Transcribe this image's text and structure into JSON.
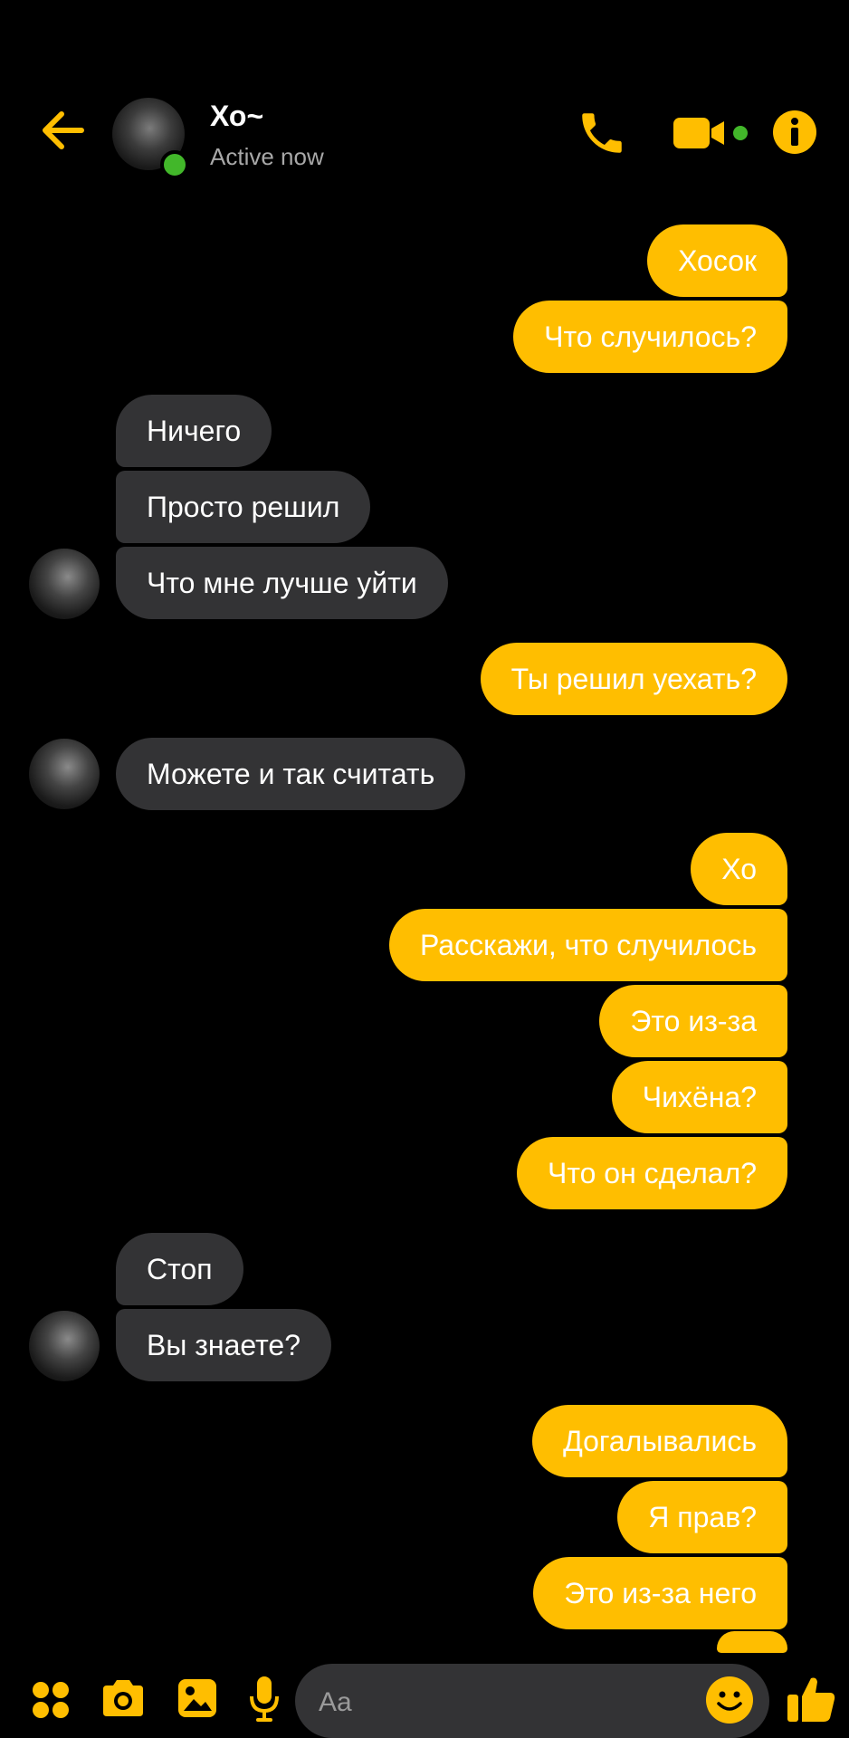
{
  "theme": {
    "accent": "#ffbe00",
    "background": "#000000",
    "incoming_bubble": "#333335",
    "online": "#42b72a"
  },
  "header": {
    "contact_name": "Хо~",
    "status": "Active now",
    "icons": [
      "back-arrow-icon",
      "phone-icon",
      "video-camera-icon",
      "info-icon"
    ]
  },
  "messages": [
    {
      "from": "me",
      "text": "Хосок"
    },
    {
      "from": "me",
      "text": "Что случилось?"
    },
    {
      "from": "contact",
      "text": "Ничего"
    },
    {
      "from": "contact",
      "text": "Просто решил"
    },
    {
      "from": "contact",
      "text": "Что мне лучше уйти"
    },
    {
      "from": "me",
      "text": "Ты решил уехать?"
    },
    {
      "from": "contact",
      "text": "Можете и так считать"
    },
    {
      "from": "me",
      "text": "Хо"
    },
    {
      "from": "me",
      "text": "Расскажи, что случилось"
    },
    {
      "from": "me",
      "text": "Это из-за"
    },
    {
      "from": "me",
      "text": "Чихёна?"
    },
    {
      "from": "me",
      "text": "Что он сделал?"
    },
    {
      "from": "contact",
      "text": "Стоп"
    },
    {
      "from": "contact",
      "text": "Вы знаете?"
    },
    {
      "from": "me",
      "text": "Догалывались"
    },
    {
      "from": "me",
      "text": "Я прав?"
    },
    {
      "from": "me",
      "text": "Это из-за него"
    }
  ],
  "composer": {
    "placeholder": "Aa",
    "icons": [
      "apps-icon",
      "camera-icon",
      "gallery-icon",
      "microphone-icon",
      "emoji-icon",
      "thumbs-up-icon"
    ]
  }
}
